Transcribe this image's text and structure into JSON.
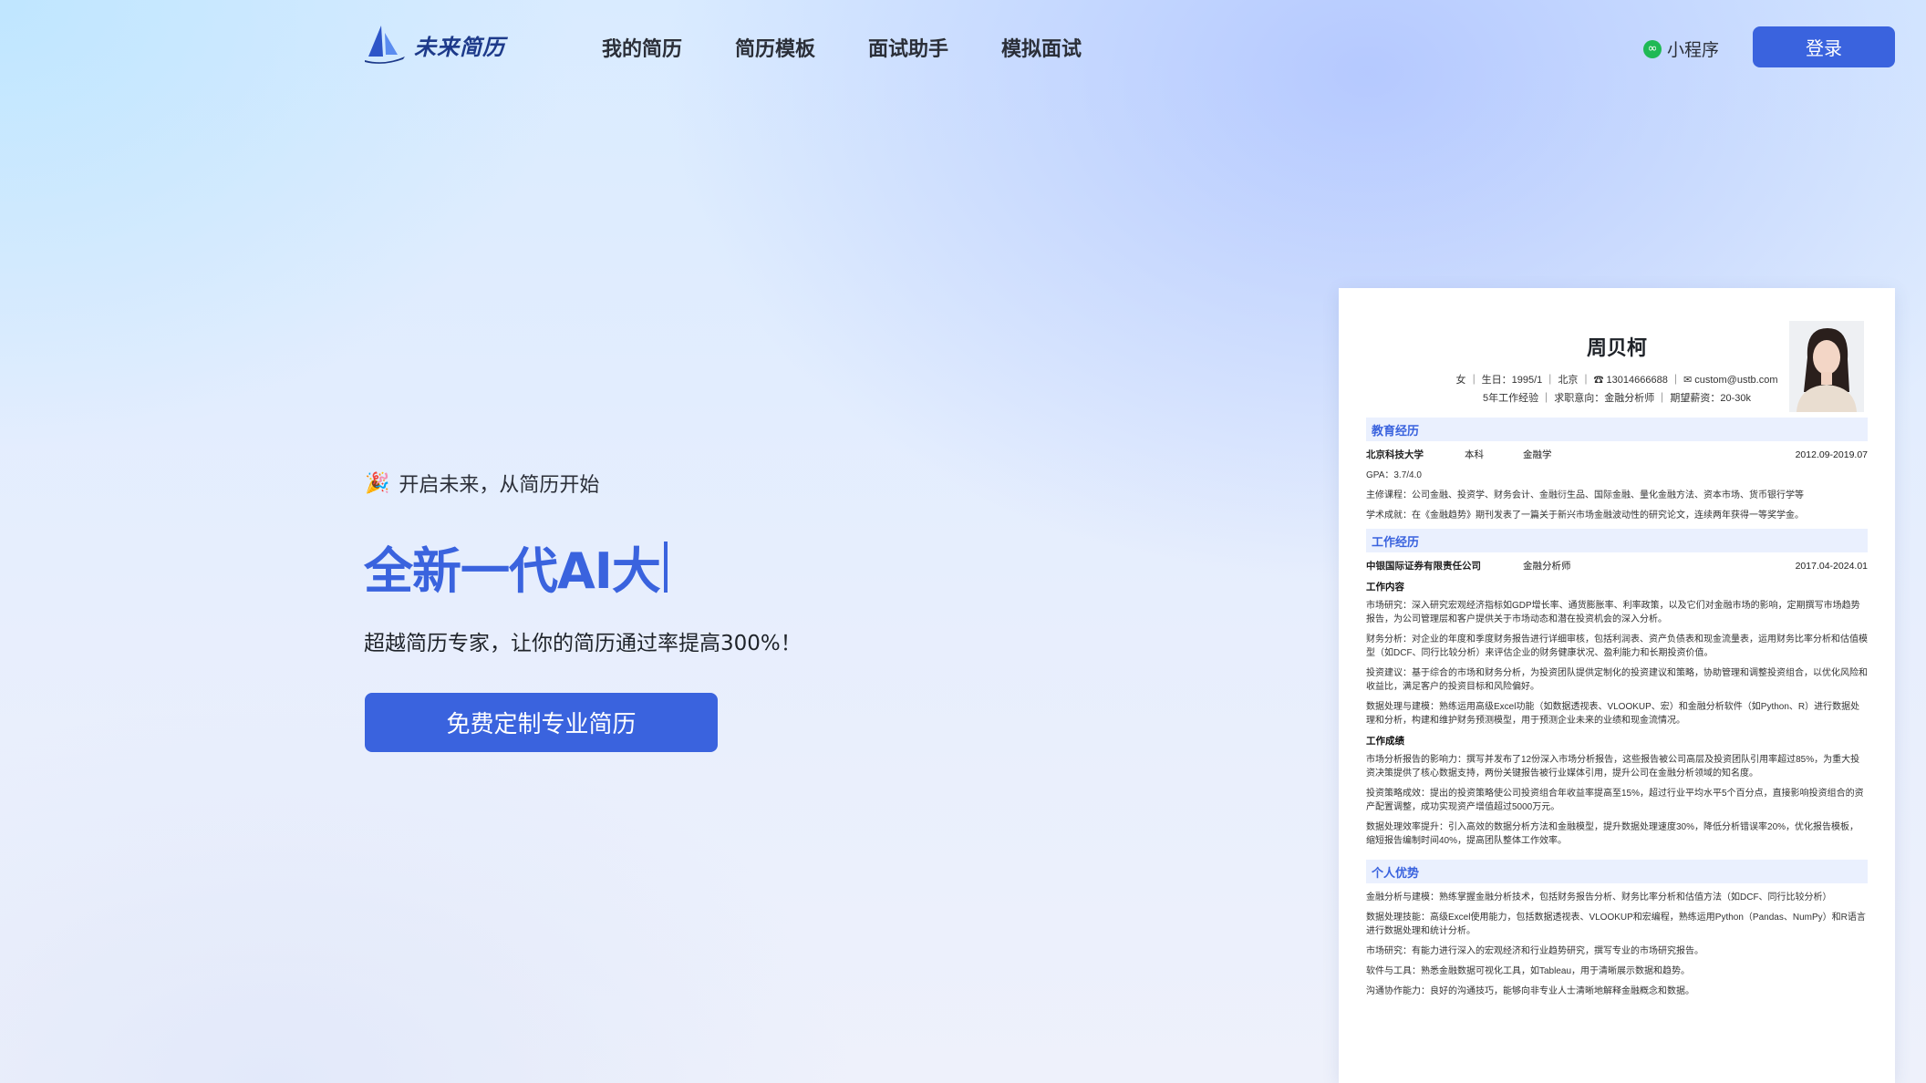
{
  "header": {
    "logo_text": "未来简历",
    "nav": [
      "我的简历",
      "简历模板",
      "面试助手",
      "模拟面试"
    ],
    "mini_program": "小程序",
    "login": "登录"
  },
  "hero": {
    "tagline": "开启未来，从简历开始",
    "headline": "全新一代AI大",
    "subtitle": "超越简历专家，让你的简历通过率提高300%！",
    "cta": "免费定制专业简历"
  },
  "icons": {
    "logo": "sailboat-logo-icon",
    "mini_program": "wechat-miniprogram-icon",
    "tagline": "party-popper-icon",
    "phone": "phone-icon",
    "email": "email-icon"
  },
  "colors": {
    "accent": "#3a63de",
    "section_bg": "#eaf0fe"
  },
  "resume": {
    "name": "周贝柯",
    "info_line1": "女 ｜ 生日：1995/1 ｜ 北京 ｜ ☎ 13014666688 ｜ ✉ custom@ustb.com",
    "info_line2": "5年工作经验 ｜ 求职意向：金融分析师 ｜ 期望薪资：20-30k",
    "education": {
      "title": "教育经历",
      "school": "北京科技大学",
      "degree": "本科",
      "major": "金融学",
      "period": "2012.09-2019.07",
      "gpa": "GPA：3.7/4.0",
      "courses": "主修课程：公司金融、投资学、财务会计、金融衍生品、国际金融、量化金融方法、资本市场、货币银行学等",
      "achievement": "学术成就：在《金融趋势》期刊发表了一篇关于新兴市场金融波动性的研究论文，连续两年获得一等奖学金。"
    },
    "work": {
      "title": "工作经历",
      "company": "中银国际证券有限责任公司",
      "role": "金融分析师",
      "period": "2017.04-2024.01",
      "content_title": "工作内容",
      "content": [
        "市场研究：深入研究宏观经济指标如GDP增长率、通货膨胀率、利率政策，以及它们对金融市场的影响，定期撰写市场趋势报告，为公司管理层和客户提供关于市场动态和潜在投资机会的深入分析。",
        "财务分析：对企业的年度和季度财务报告进行详细审核，包括利润表、资产负债表和现金流量表，运用财务比率分析和估值模型（如DCF、同行比较分析）来评估企业的财务健康状况、盈利能力和长期投资价值。",
        "投资建议：基于综合的市场和财务分析，为投资团队提供定制化的投资建议和策略，协助管理和调整投资组合，以优化风险和收益比，满足客户的投资目标和风险偏好。",
        "数据处理与建模：熟练运用高级Excel功能（如数据透视表、VLOOKUP、宏）和金融分析软件（如Python、R）进行数据处理和分析，构建和维护财务预测模型，用于预测企业未来的业绩和现金流情况。"
      ],
      "result_title": "工作成绩",
      "results": [
        "市场分析报告的影响力：撰写并发布了12份深入市场分析报告，这些报告被公司高层及投资团队引用率超过85%，为重大投资决策提供了核心数据支持，两份关键报告被行业媒体引用，提升公司在金融分析领域的知名度。",
        "投资策略成效：提出的投资策略使公司投资组合年收益率提高至15%，超过行业平均水平5个百分点，直接影响投资组合的资产配置调整，成功实现资产增值超过5000万元。",
        "数据处理效率提升：引入高效的数据分析方法和金融模型，提升数据处理速度30%，降低分析错误率20%，优化报告模板，缩短报告编制时间40%，提高团队整体工作效率。"
      ]
    },
    "strengths": {
      "title": "个人优势",
      "items": [
        "金融分析与建模：熟练掌握金融分析技术，包括财务报告分析、财务比率分析和估值方法（如DCF、同行比较分析）",
        "数据处理技能：高级Excel使用能力，包括数据透视表、VLOOKUP和宏编程，熟练运用Python（Pandas、NumPy）和R语言进行数据处理和统计分析。",
        "市场研究：有能力进行深入的宏观经济和行业趋势研究，撰写专业的市场研究报告。",
        "软件与工具：熟悉金融数据可视化工具，如Tableau，用于清晰展示数据和趋势。",
        "沟通协作能力：良好的沟通技巧，能够向非专业人士清晰地解释金融概念和数据。"
      ]
    }
  }
}
